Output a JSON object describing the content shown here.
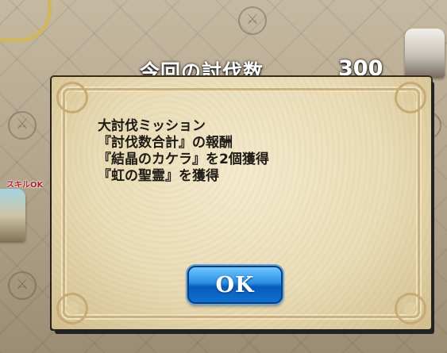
{
  "hud": {
    "label": "今回の討伐数",
    "value": "300"
  },
  "board": {
    "skill_badge": "スキルOK"
  },
  "dialog": {
    "lines": [
      "大討伐ミッション",
      "『討伐数合計』の報酬",
      "『結晶のカケラ』を2個獲得",
      "『虹の聖霊』を獲得"
    ],
    "ok_label": "OK"
  },
  "colors": {
    "ok_button": "#1a7fdc",
    "parchment": "#efe3c3",
    "skill_badge": "#c81b2e"
  }
}
